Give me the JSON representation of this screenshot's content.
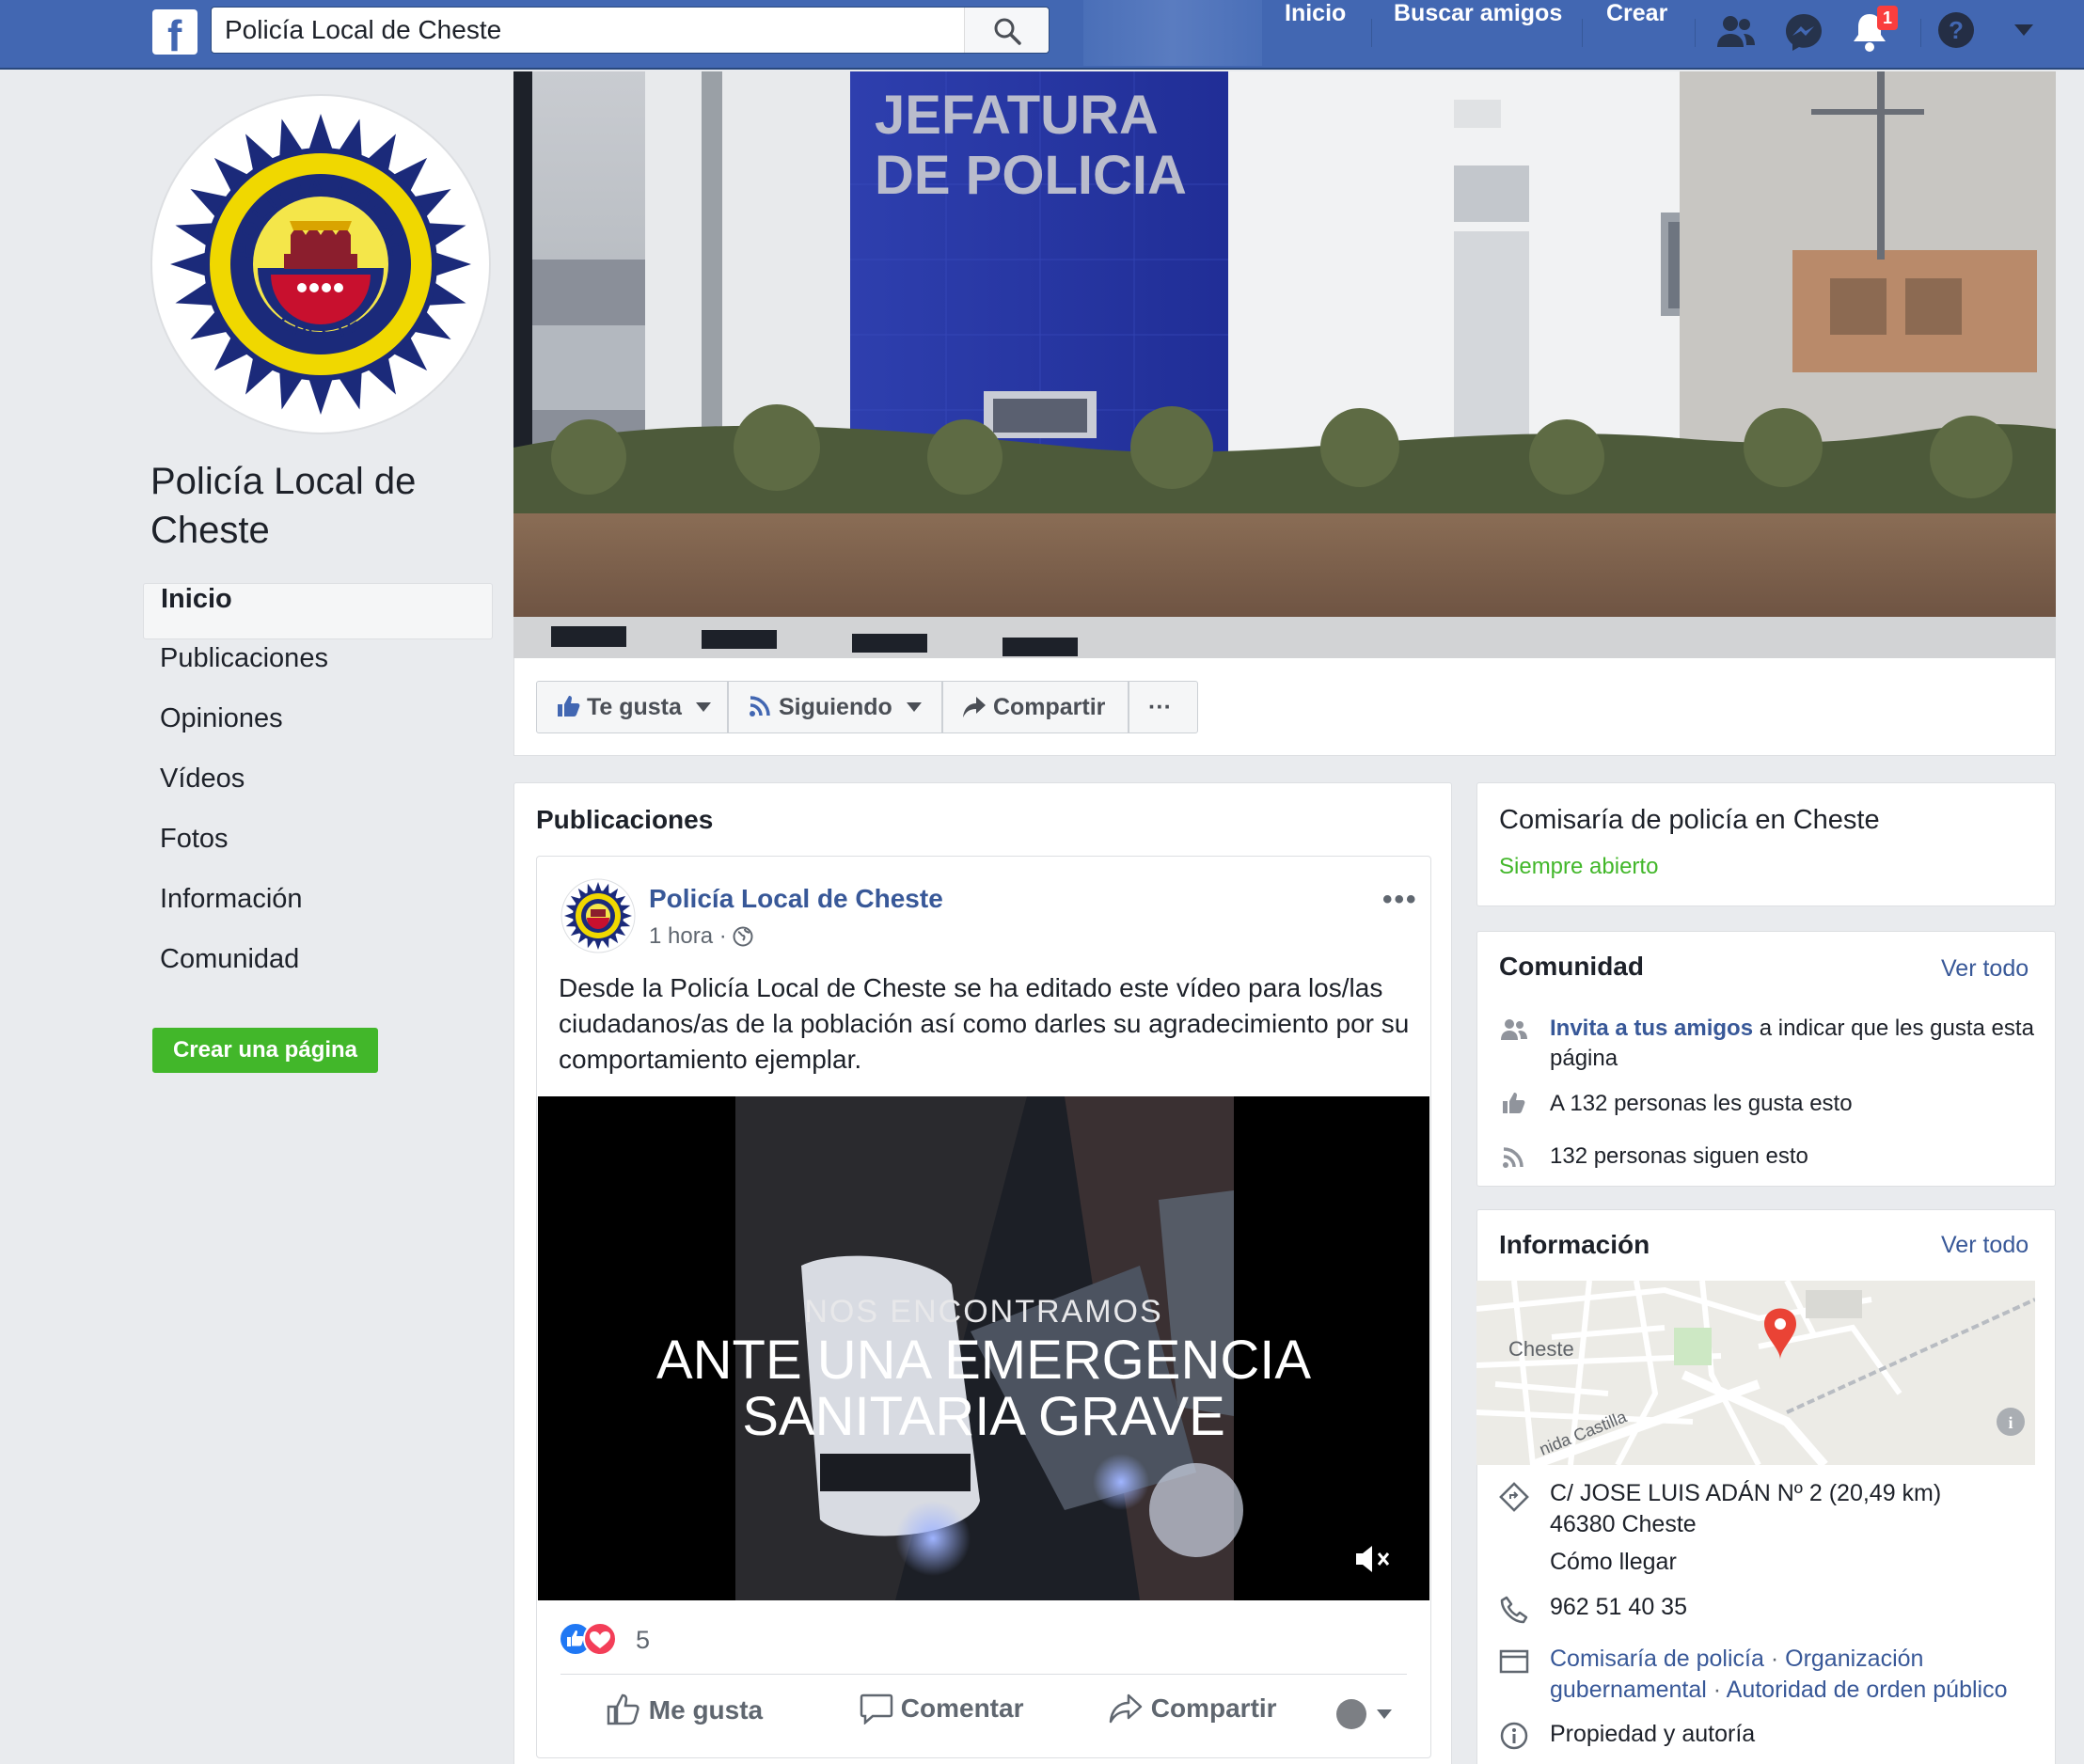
{
  "topbar": {
    "search_value": "Policía Local de Cheste",
    "nav": [
      "Inicio",
      "Buscar amigos",
      "Crear"
    ],
    "notification_count": "1",
    "brand_color": "#4267b2"
  },
  "sidebar": {
    "page_name": "Policía Local de Cheste",
    "items": [
      {
        "label": "Inicio",
        "active": true
      },
      {
        "label": "Publicaciones"
      },
      {
        "label": "Opiniones"
      },
      {
        "label": "Vídeos"
      },
      {
        "label": "Fotos"
      },
      {
        "label": "Información"
      },
      {
        "label": "Comunidad"
      }
    ],
    "create_page_label": "Crear una página"
  },
  "logo": {
    "top_text": "POLICIA LOCAL",
    "bottom_text": "CHESTE"
  },
  "cover": {
    "sign_line1": "JEFATURA",
    "sign_line2": "DE POLICIA"
  },
  "actions": {
    "like": "Te gusta",
    "follow": "Siguiendo",
    "share": "Compartir",
    "more": "···"
  },
  "feed": {
    "section_title": "Publicaciones",
    "post": {
      "author": "Policía Local de Cheste",
      "time": "1 hora",
      "text": "Desde la Policía Local de Cheste se ha editado este vídeo para los/las ciudadanos/as de la población así como darles su agradecimiento por su comportamiento ejemplar.",
      "video_line1": "NOS ENCONTRAMOS",
      "video_line2": "ANTE UNA EMERGENCIA",
      "video_line3": "SANITARIA GRAVE",
      "reactions_count": "5",
      "like_btn": "Me gusta",
      "comment_btn": "Comentar",
      "share_btn": "Compartir"
    }
  },
  "right": {
    "category": "Comisaría de policía en Cheste",
    "open_status": "Siempre abierto",
    "community": {
      "title": "Comunidad",
      "see_all": "Ver todo",
      "invite_link": "Invita a tus amigos",
      "invite_rest": "a indicar que les gusta esta página",
      "likes": "A 132 personas les gusta esto",
      "follows": "132 personas siguen esto"
    },
    "info": {
      "title": "Información",
      "see_all": "Ver todo",
      "map_town": "Cheste",
      "map_street": "nida Castilla",
      "address_line1": "C/ JOSE LUIS ADÁN Nº 2 (20,49 km)",
      "address_line2": "46380 Cheste",
      "directions": "Cómo llegar",
      "phone": "962 51 40 35",
      "categories_1a": "Comisaría de policía",
      "categories_1b": "Organización",
      "categories_2a": "gubernamental",
      "categories_2b": "Autoridad de orden público",
      "ownership": "Propiedad y autoría"
    }
  }
}
